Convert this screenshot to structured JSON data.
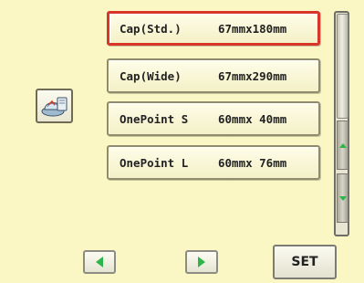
{
  "hoop_list": {
    "items": [
      {
        "name": "Cap(Std.)",
        "size": "67mmx180mm",
        "selected": true
      },
      {
        "name": "Cap(Wide)",
        "size": "67mmx290mm",
        "selected": false
      },
      {
        "name": "OnePoint S",
        "size": "60mmx 40mm",
        "selected": false
      },
      {
        "name": "OnePoint L",
        "size": "60mmx 76mm",
        "selected": false
      }
    ]
  },
  "hoop_icon": {
    "icon": "cap-frame-icon"
  },
  "scrollbar": {
    "up_icon": "arrow-up-icon",
    "down_icon": "arrow-down-icon"
  },
  "bottom_bar": {
    "prev_icon": "arrow-left-icon",
    "next_icon": "arrow-right-icon",
    "set_label": "SET"
  },
  "colors": {
    "background": "#fbf7c4",
    "selection_border": "#d9362a",
    "arrow_green": "#2eb54a"
  }
}
